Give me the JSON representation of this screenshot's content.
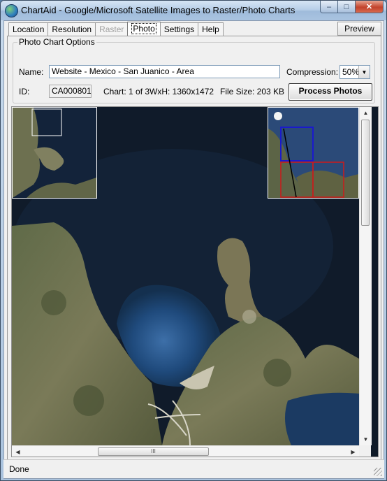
{
  "window": {
    "title": "ChartAid - Google/Microsoft Satellite Images to Raster/Photo Charts",
    "controls": {
      "minimize": "–",
      "maximize": "□",
      "close": "✕"
    }
  },
  "tabs": [
    {
      "label": "Location",
      "state": "normal"
    },
    {
      "label": "Resolution",
      "state": "normal"
    },
    {
      "label": "Raster",
      "state": "disabled"
    },
    {
      "label": "Photo",
      "state": "active"
    },
    {
      "label": "Settings",
      "state": "normal"
    },
    {
      "label": "Help",
      "state": "normal"
    }
  ],
  "preview_label": "Preview",
  "options": {
    "group_title": "Photo Chart Options",
    "name_label": "Name:",
    "name_value": "Website - Mexico - San Juanico - Area",
    "compression_label": "Compression:",
    "compression_value": "50%",
    "id_label": "ID:",
    "id_value": "CA000801",
    "chart_info": "Chart: 1 of 3",
    "dims_info": "WxH: 1360x1472",
    "filesize_info": "File Size: 203 KB",
    "process_label": "Process Photos"
  },
  "icons": {
    "app": "globe-icon",
    "dropdown": "chevron-down-icon",
    "scroll_up": "arrow-up-icon",
    "scroll_down": "arrow-down-icon",
    "scroll_left": "arrow-left-icon",
    "scroll_right": "arrow-right-icon",
    "thumb_grip": "grip-icon"
  },
  "scroll_grip": "III",
  "status": {
    "text": "Done"
  },
  "colors": {
    "water": "#0f1c2e",
    "land": "#6b6a4a",
    "overview_blue": "#1a1acc",
    "overview_red": "#cc1a1a",
    "overview_black": "#000000"
  }
}
